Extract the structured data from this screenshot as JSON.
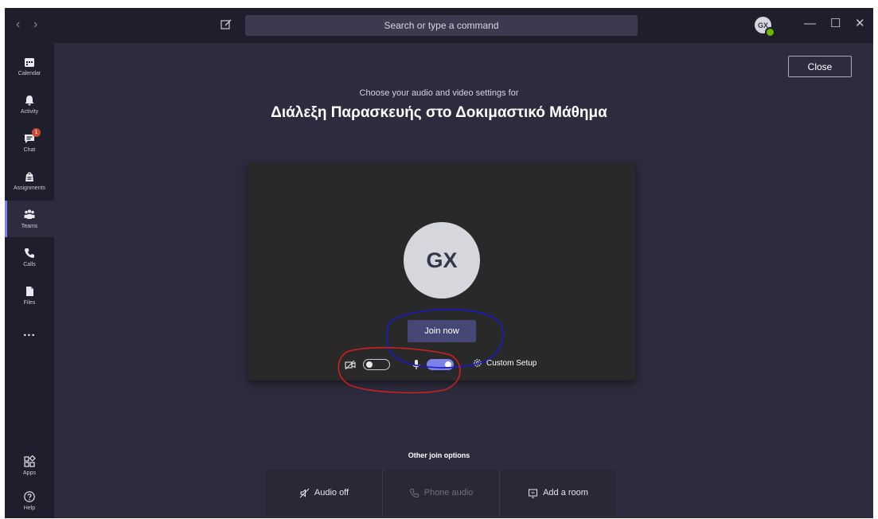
{
  "titlebar": {
    "search_placeholder": "Search or type a command",
    "avatar_initials": "GX",
    "nav_back": "‹",
    "nav_forward": "›",
    "minimize": "—",
    "maximize": "☐",
    "close": "✕"
  },
  "rail": {
    "items": [
      {
        "label": "Calendar",
        "icon": "calendar-icon"
      },
      {
        "label": "Activity",
        "icon": "bell-icon"
      },
      {
        "label": "Chat",
        "icon": "chat-icon",
        "badge": "1"
      },
      {
        "label": "Assignments",
        "icon": "assignments-icon"
      },
      {
        "label": "Teams",
        "icon": "teams-icon",
        "active": true
      },
      {
        "label": "Calls",
        "icon": "phone-icon"
      },
      {
        "label": "Files",
        "icon": "file-icon"
      },
      {
        "label": "...",
        "icon": "more-icon"
      },
      {
        "label": "Apps",
        "icon": "apps-icon"
      },
      {
        "label": "Help",
        "icon": "help-icon"
      }
    ]
  },
  "main": {
    "close_label": "Close",
    "subtitle": "Choose your audio and video settings for",
    "meeting_title": "Διάλεξη Παρασκευής στο Δοκιμαστικό Μάθημα",
    "avatar_initials": "GX",
    "join_label": "Join now",
    "camera_on": false,
    "mic_on": true,
    "custom_setup_label": "Custom Setup",
    "other_options_label": "Other join options",
    "join_options": [
      {
        "label": "Audio off",
        "icon": "speaker-off-icon",
        "enabled": true
      },
      {
        "label": "Phone audio",
        "icon": "phone-icon",
        "enabled": false
      },
      {
        "label": "Add a room",
        "icon": "room-icon",
        "enabled": true
      }
    ]
  },
  "colors": {
    "background": "#2d2c3e",
    "titlebar": "#1f1e2c",
    "accent": "#7b83eb",
    "join_button": "#464775",
    "annotation_red": "#cc1f1f",
    "annotation_blue": "#1a1acc"
  }
}
